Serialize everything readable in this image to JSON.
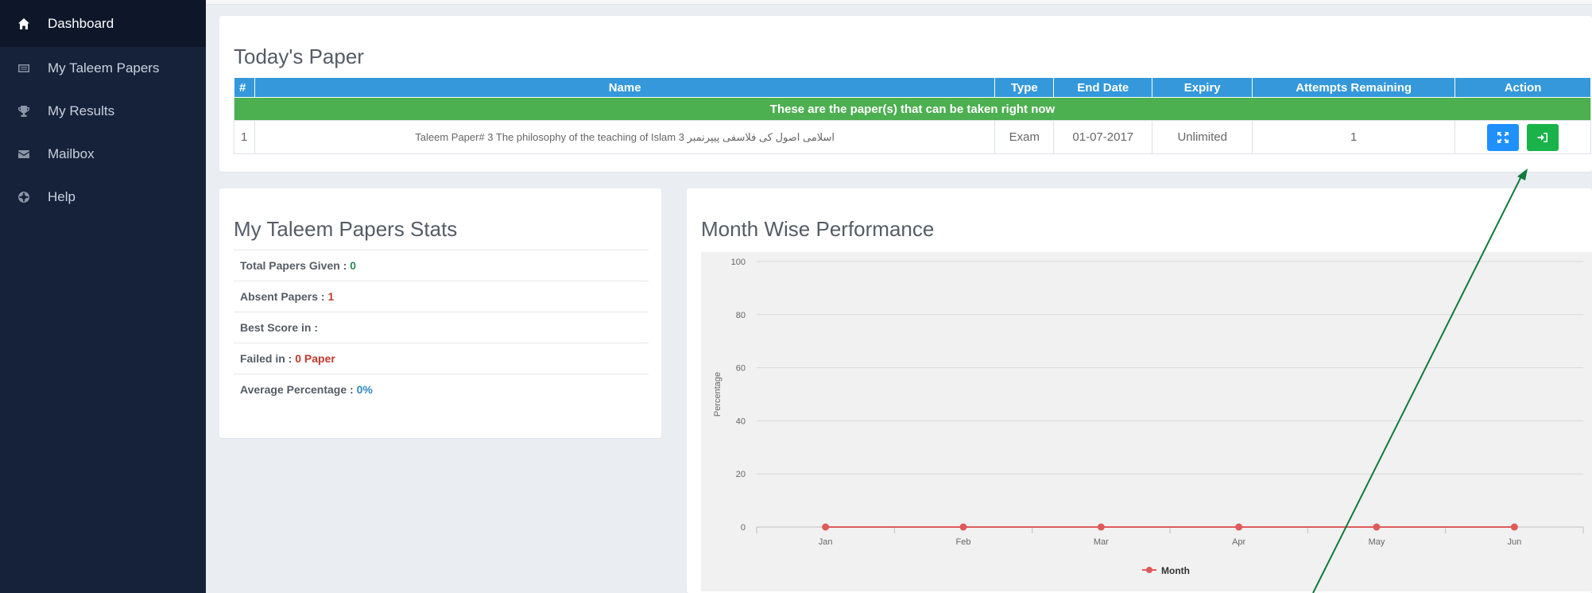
{
  "sidebar": {
    "items": [
      {
        "label": "Dashboard",
        "icon": "home-icon",
        "active": true
      },
      {
        "label": "My Taleem Papers",
        "icon": "list-icon"
      },
      {
        "label": "My Results",
        "icon": "trophy-icon"
      },
      {
        "label": "Mailbox",
        "icon": "mail-icon"
      },
      {
        "label": "Help",
        "icon": "lifebuoy-icon"
      }
    ]
  },
  "todays_paper": {
    "title": "Today's Paper",
    "headers": [
      "#",
      "Name",
      "Type",
      "End Date",
      "Expiry",
      "Attempts Remaining",
      "Action"
    ],
    "banner": "These are the paper(s) that can be taken right now",
    "rows": [
      {
        "num": "1",
        "name": "Taleem Paper# 3 The philosophy of the teaching of Islam 3 اسلامی اصول کی فلاسفی پیپرنمبر",
        "type": "Exam",
        "end_date": "01-07-2017",
        "expiry": "Unlimited",
        "attempts": "1",
        "actions": [
          {
            "icon": "expand-icon",
            "color": "#1e90ff"
          },
          {
            "icon": "sign-in-icon",
            "color": "#19b34a"
          }
        ]
      }
    ]
  },
  "stats": {
    "title": "My Taleem Papers Stats",
    "items": [
      {
        "label": "Total Papers Given : ",
        "value": "0",
        "value_color": "green"
      },
      {
        "label": "Absent Papers : ",
        "value": "1",
        "value_color": "red"
      },
      {
        "label": "Best Score in : ",
        "value": "",
        "value_color": ""
      },
      {
        "label": "Failed in : ",
        "value": "0 Paper",
        "value_color": "red"
      },
      {
        "label": "Average Percentage : ",
        "value": "0%",
        "value_color": "blue"
      }
    ]
  },
  "performance": {
    "title": "Month Wise Performance"
  },
  "chart_data": {
    "type": "line",
    "x": [
      "Jan",
      "Feb",
      "Mar",
      "Apr",
      "May",
      "Jun"
    ],
    "series": [
      {
        "name": "Month",
        "values": [
          0,
          0,
          0,
          0,
          0,
          0
        ],
        "color": "#e05a5a"
      }
    ],
    "ylabel": "Percentage",
    "xlabel": "",
    "ylim": [
      0,
      100
    ],
    "yticks": [
      0,
      20,
      40,
      60,
      80,
      100
    ],
    "grid": true,
    "legend": "bottom-center"
  },
  "colors": {
    "sidebar_bg": "#16223a",
    "header_blue": "#3498db",
    "banner_green": "#4caf50",
    "arrow_green": "#117a3c"
  }
}
